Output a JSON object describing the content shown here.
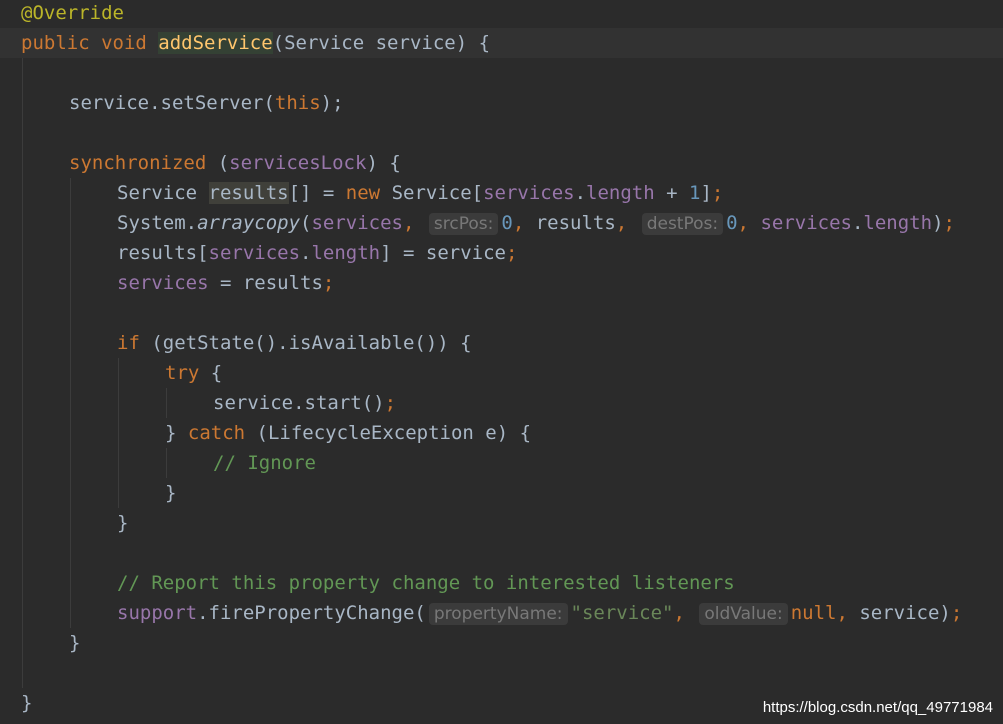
{
  "watermark": "https://blog.csdn.net/qq_49771984",
  "lines": [
    {
      "indent": 0,
      "tokens": [
        {
          "t": "@Override",
          "c": "ann"
        }
      ]
    },
    {
      "indent": 0,
      "current": true,
      "tokens": [
        {
          "t": "public ",
          "c": "kw"
        },
        {
          "t": "void ",
          "c": "kw"
        },
        {
          "t": "addService",
          "c": "mth hl-def"
        },
        {
          "t": "(Service service) {"
        }
      ]
    },
    {
      "indent": 0,
      "tokens": []
    },
    {
      "indent": 1,
      "tokens": [
        {
          "t": "service.setServer("
        },
        {
          "t": "this",
          "c": "kw"
        },
        {
          "t": ");"
        }
      ]
    },
    {
      "indent": 0,
      "tokens": []
    },
    {
      "indent": 1,
      "tokens": [
        {
          "t": "synchronized ",
          "c": "kw"
        },
        {
          "t": "("
        },
        {
          "t": "servicesLock",
          "c": "fld"
        },
        {
          "t": ") {"
        }
      ]
    },
    {
      "indent": 2,
      "tokens": [
        {
          "t": "Service "
        },
        {
          "t": "results",
          "c": "hl-use"
        },
        {
          "t": "[] = "
        },
        {
          "t": "new ",
          "c": "kw"
        },
        {
          "t": "Service["
        },
        {
          "t": "services",
          "c": "fld"
        },
        {
          "t": "."
        },
        {
          "t": "length",
          "c": "fld"
        },
        {
          "t": " + "
        },
        {
          "t": "1",
          "c": "num"
        },
        {
          "t": "]"
        },
        {
          "t": ";",
          "c": "kw"
        }
      ]
    },
    {
      "indent": 2,
      "tokens": [
        {
          "t": "System."
        },
        {
          "t": "arraycopy",
          "c": "ital"
        },
        {
          "t": "("
        },
        {
          "t": "services",
          "c": "fld"
        },
        {
          "t": ",",
          "c": "kw"
        },
        {
          "t": " "
        },
        {
          "hint": "srcPos:"
        },
        {
          "t": "0",
          "c": "num"
        },
        {
          "t": ",",
          "c": "kw"
        },
        {
          "t": " results"
        },
        {
          "t": ",",
          "c": "kw"
        },
        {
          "t": " "
        },
        {
          "hint": "destPos:"
        },
        {
          "t": "0",
          "c": "num"
        },
        {
          "t": ",",
          "c": "kw"
        },
        {
          "t": " "
        },
        {
          "t": "services",
          "c": "fld"
        },
        {
          "t": "."
        },
        {
          "t": "length",
          "c": "fld"
        },
        {
          "t": ")"
        },
        {
          "t": ";",
          "c": "kw"
        }
      ]
    },
    {
      "indent": 2,
      "tokens": [
        {
          "t": "results["
        },
        {
          "t": "services",
          "c": "fld"
        },
        {
          "t": "."
        },
        {
          "t": "length",
          "c": "fld"
        },
        {
          "t": "] = service"
        },
        {
          "t": ";",
          "c": "kw"
        }
      ]
    },
    {
      "indent": 2,
      "tokens": [
        {
          "t": "services",
          "c": "fld"
        },
        {
          "t": " = results"
        },
        {
          "t": ";",
          "c": "kw"
        }
      ]
    },
    {
      "indent": 0,
      "tokens": []
    },
    {
      "indent": 2,
      "tokens": [
        {
          "t": "if ",
          "c": "kw"
        },
        {
          "t": "(getState().isAvailable()) {"
        }
      ]
    },
    {
      "indent": 3,
      "tokens": [
        {
          "t": "try ",
          "c": "kw"
        },
        {
          "t": "{"
        }
      ]
    },
    {
      "indent": 4,
      "tokens": [
        {
          "t": "service.start()"
        },
        {
          "t": ";",
          "c": "kw"
        }
      ]
    },
    {
      "indent": 3,
      "tokens": [
        {
          "t": "} "
        },
        {
          "t": "catch ",
          "c": "kw"
        },
        {
          "t": "(LifecycleException e) {"
        }
      ]
    },
    {
      "indent": 4,
      "tokens": [
        {
          "t": "// Ignore",
          "c": "cmt"
        }
      ]
    },
    {
      "indent": 3,
      "tokens": [
        {
          "t": "}"
        }
      ]
    },
    {
      "indent": 2,
      "tokens": [
        {
          "t": "}"
        }
      ]
    },
    {
      "indent": 0,
      "tokens": []
    },
    {
      "indent": 2,
      "tokens": [
        {
          "t": "// Report this property change to interested listeners",
          "c": "cmt"
        }
      ]
    },
    {
      "indent": 2,
      "tokens": [
        {
          "t": "support",
          "c": "fld"
        },
        {
          "t": ".firePropertyChange("
        },
        {
          "hint": "propertyName:"
        },
        {
          "t": "\"service\"",
          "c": "str"
        },
        {
          "t": ",",
          "c": "kw"
        },
        {
          "t": " "
        },
        {
          "hint": "oldValue:"
        },
        {
          "t": "null",
          "c": "kw"
        },
        {
          "t": ",",
          "c": "kw"
        },
        {
          "t": " service)"
        },
        {
          "t": ";",
          "c": "kw"
        }
      ]
    },
    {
      "indent": 1,
      "tokens": [
        {
          "t": "}"
        }
      ]
    },
    {
      "indent": 0,
      "tokens": []
    },
    {
      "indent": 0,
      "tokens": [
        {
          "t": "}"
        }
      ]
    }
  ]
}
